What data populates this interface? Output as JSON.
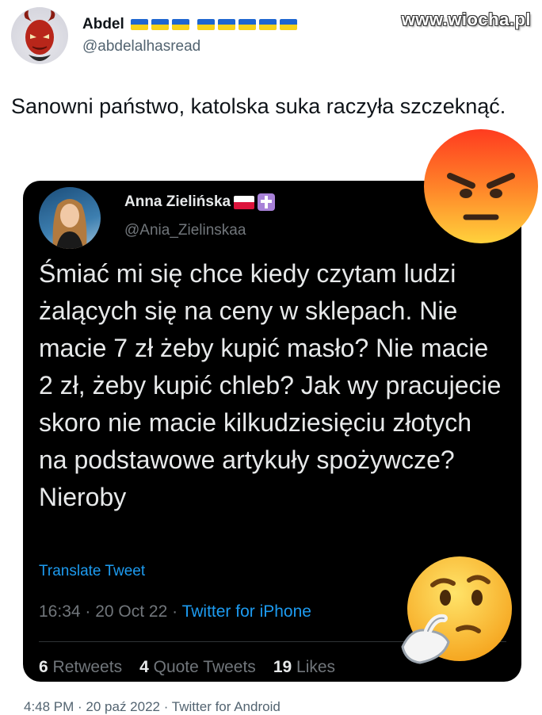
{
  "watermark": "www.wiocha.pl",
  "outer_tweet": {
    "display_name": "Abdel",
    "handle": "@abdelalhasread",
    "text": "Sanowni państwo, katolska suka raczyła szczeknąć.",
    "footer": "4:48 PM · 20 paź 2022 · Twitter for Android"
  },
  "quoted_tweet": {
    "display_name": "Anna Zielińska",
    "handle": "@Ania_Zielinskaa",
    "text": "Śmiać mi się chce kiedy czytam ludzi żalących się na ceny w sklepach. Nie macie 7 zł żeby kupić masło? Nie macie 2 zł, żeby kupić chleb? Jak wy pracujecie skoro nie macie kilkudziesięciu złotych na podstawowe artykuły spożywcze? Nieroby",
    "translate_label": "Translate Tweet",
    "time_date": "16:34 · 20 Oct 22 · ",
    "client": "Twitter for iPhone",
    "stats": [
      {
        "count": "6",
        "label": "Retweets"
      },
      {
        "count": "4",
        "label": "Quote Tweets"
      },
      {
        "count": "19",
        "label": "Likes"
      }
    ]
  },
  "icons": {
    "ua_flags": "ukraine-flag-icon",
    "pl_flag": "poland-flag-icon",
    "cross": "latin-cross-icon",
    "angry": "angry-face-emoji",
    "thinking": "thinking-face-emoji"
  },
  "colors": {
    "link_blue": "#1d9bf0",
    "card_bg": "#000000",
    "secondary_gray": "#536471"
  }
}
